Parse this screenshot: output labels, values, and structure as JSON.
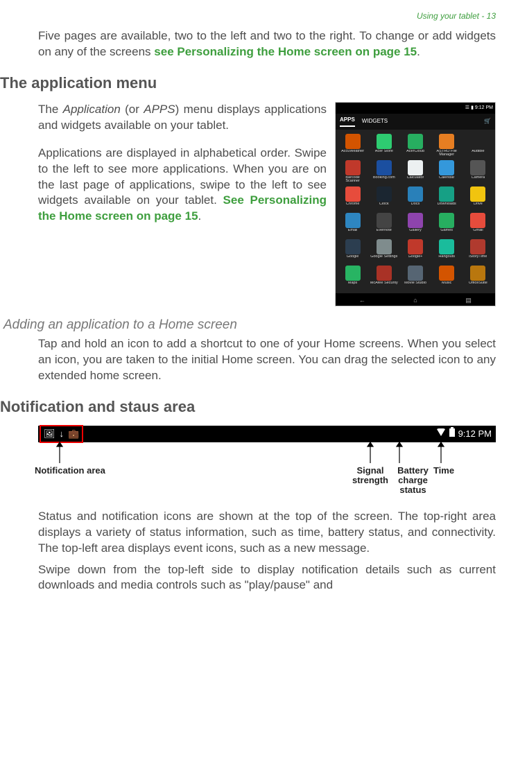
{
  "header": {
    "text": "Using your tablet - 13"
  },
  "intro": {
    "p1a": "Five pages are available, two to the left and two to the right. To change or add widgets on any of the screens ",
    "link1": "see Personalizing the Home screen on page 15",
    "p1b": "."
  },
  "app_menu": {
    "heading": "The application menu",
    "p1a": "The ",
    "p1_em1": "Application",
    "p1b": " (or ",
    "p1_em2": "APPS",
    "p1c": ") menu displays applications and widgets available on your tablet.",
    "p2a": "Applications are displayed in alphabetical order. Swipe to the left to see more applications. When you are on the last page of applications, swipe to the left to see widgets available on your tablet. ",
    "link2": "See Personalizing the Home screen on page 15",
    "p2b": "."
  },
  "screenshot": {
    "status_time": "9:12 PM",
    "tab_apps": "APPS",
    "tab_widgets": "WIDGETS",
    "apps": [
      {
        "n": "AccuWeather",
        "c": "#d35400"
      },
      {
        "n": "Acer Store",
        "c": "#2ecc71"
      },
      {
        "n": "AcerCloud",
        "c": "#27ae60"
      },
      {
        "n": "ASTRO File Manager",
        "c": "#e67e22"
      },
      {
        "n": "Audible",
        "c": "#222222"
      },
      {
        "n": "Barcode Scanner",
        "c": "#c0392b"
      },
      {
        "n": "Booking.com",
        "c": "#1b4fa0"
      },
      {
        "n": "Calculator",
        "c": "#ecf0f1"
      },
      {
        "n": "Calendar",
        "c": "#3498db"
      },
      {
        "n": "Camera",
        "c": "#555555"
      },
      {
        "n": "Chrome",
        "c": "#e74c3c"
      },
      {
        "n": "Clock",
        "c": "#1b2631"
      },
      {
        "n": "Docs",
        "c": "#2980b9"
      },
      {
        "n": "Downloads",
        "c": "#16a085"
      },
      {
        "n": "Drive",
        "c": "#f1c40f"
      },
      {
        "n": "Email",
        "c": "#2e86c1"
      },
      {
        "n": "Evernote",
        "c": "#444444"
      },
      {
        "n": "Gallery",
        "c": "#8e44ad"
      },
      {
        "n": "Games",
        "c": "#27ae60"
      },
      {
        "n": "Gmail",
        "c": "#e74c3c"
      },
      {
        "n": "Google",
        "c": "#2c3e50"
      },
      {
        "n": "Google Settings",
        "c": "#7f8c8d"
      },
      {
        "n": "Google+",
        "c": "#c0392b"
      },
      {
        "n": "Hangouts",
        "c": "#1abc9c"
      },
      {
        "n": "iStoryTime",
        "c": "#b03a2e"
      },
      {
        "n": "Maps",
        "c": "#28b463"
      },
      {
        "n": "McAfee Security",
        "c": "#a93226"
      },
      {
        "n": "Movie Studio",
        "c": "#566573"
      },
      {
        "n": "Music",
        "c": "#d35400"
      },
      {
        "n": "OfficeSuite",
        "c": "#b9770e"
      }
    ]
  },
  "adding": {
    "heading": "Adding an application to a Home screen",
    "p1": "Tap and hold an icon to add a shortcut to one of your Home screens. When you select an icon, you are taken to the initial Home screen. You can drag the selected icon to any extended home screen."
  },
  "notif": {
    "heading": "Notification and staus area",
    "time": "9:12 PM",
    "labels": {
      "left": "Notification area",
      "signal": "Signal strength",
      "battery": "Battery charge status",
      "time": "Time"
    },
    "p1": "Status and notification icons are shown at the top of the screen. The top-right area displays a variety of status information, such as time, battery status, and connectivity. The top-left area displays event icons, such as a new message.",
    "p2": "Swipe down from the top-left side to display notification details such as current downloads and media controls such as \"play/pause\" and"
  }
}
